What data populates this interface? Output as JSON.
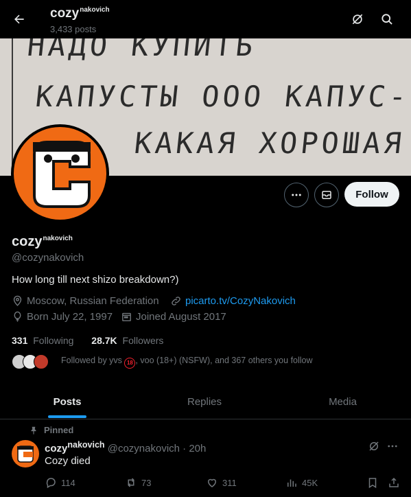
{
  "header": {
    "name": "cozy",
    "name_sup": "nakovich",
    "post_count": "3,433 posts"
  },
  "banner": {
    "line1": "НАДО КУПИТЬ",
    "line2": "КАПУСТЫ ООО КАПУС-",
    "line3": "КАКАЯ ХОРОШАЯ"
  },
  "profile": {
    "display_name": "cozy",
    "display_name_sup": "nakovich",
    "handle": "@cozynakovich",
    "bio": "How long till next shizo breakdown?)",
    "location": "Moscow, Russian Federation",
    "website": "picarto.tv/CozyNakovich",
    "birthday": "Born July 22, 1997",
    "joined": "Joined August 2017",
    "follow_label": "Follow"
  },
  "stats": {
    "following_count": "331",
    "following_label": "Following",
    "followers_count": "28.7K",
    "followers_label": "Followers"
  },
  "followed_by": {
    "prefix": "Followed by yvs",
    "badge": "18",
    "rest": ", voo (18+) (NSFW), and 367 others you follow"
  },
  "tabs": [
    {
      "label": "Posts",
      "active": true
    },
    {
      "label": "Replies",
      "active": false
    },
    {
      "label": "Media",
      "active": false
    }
  ],
  "tweet": {
    "pinned_label": "Pinned",
    "author": "cozy",
    "author_sup": "nakovich",
    "handle_time": "@cozynakovich · 20h",
    "text": "Cozy died",
    "replies": "114",
    "reposts": "73",
    "likes": "311",
    "views": "45K"
  },
  "colors": {
    "accent": "#1d9bf0",
    "avatar_orange": "#f06a14",
    "background": "#000000",
    "muted": "#71767b"
  }
}
